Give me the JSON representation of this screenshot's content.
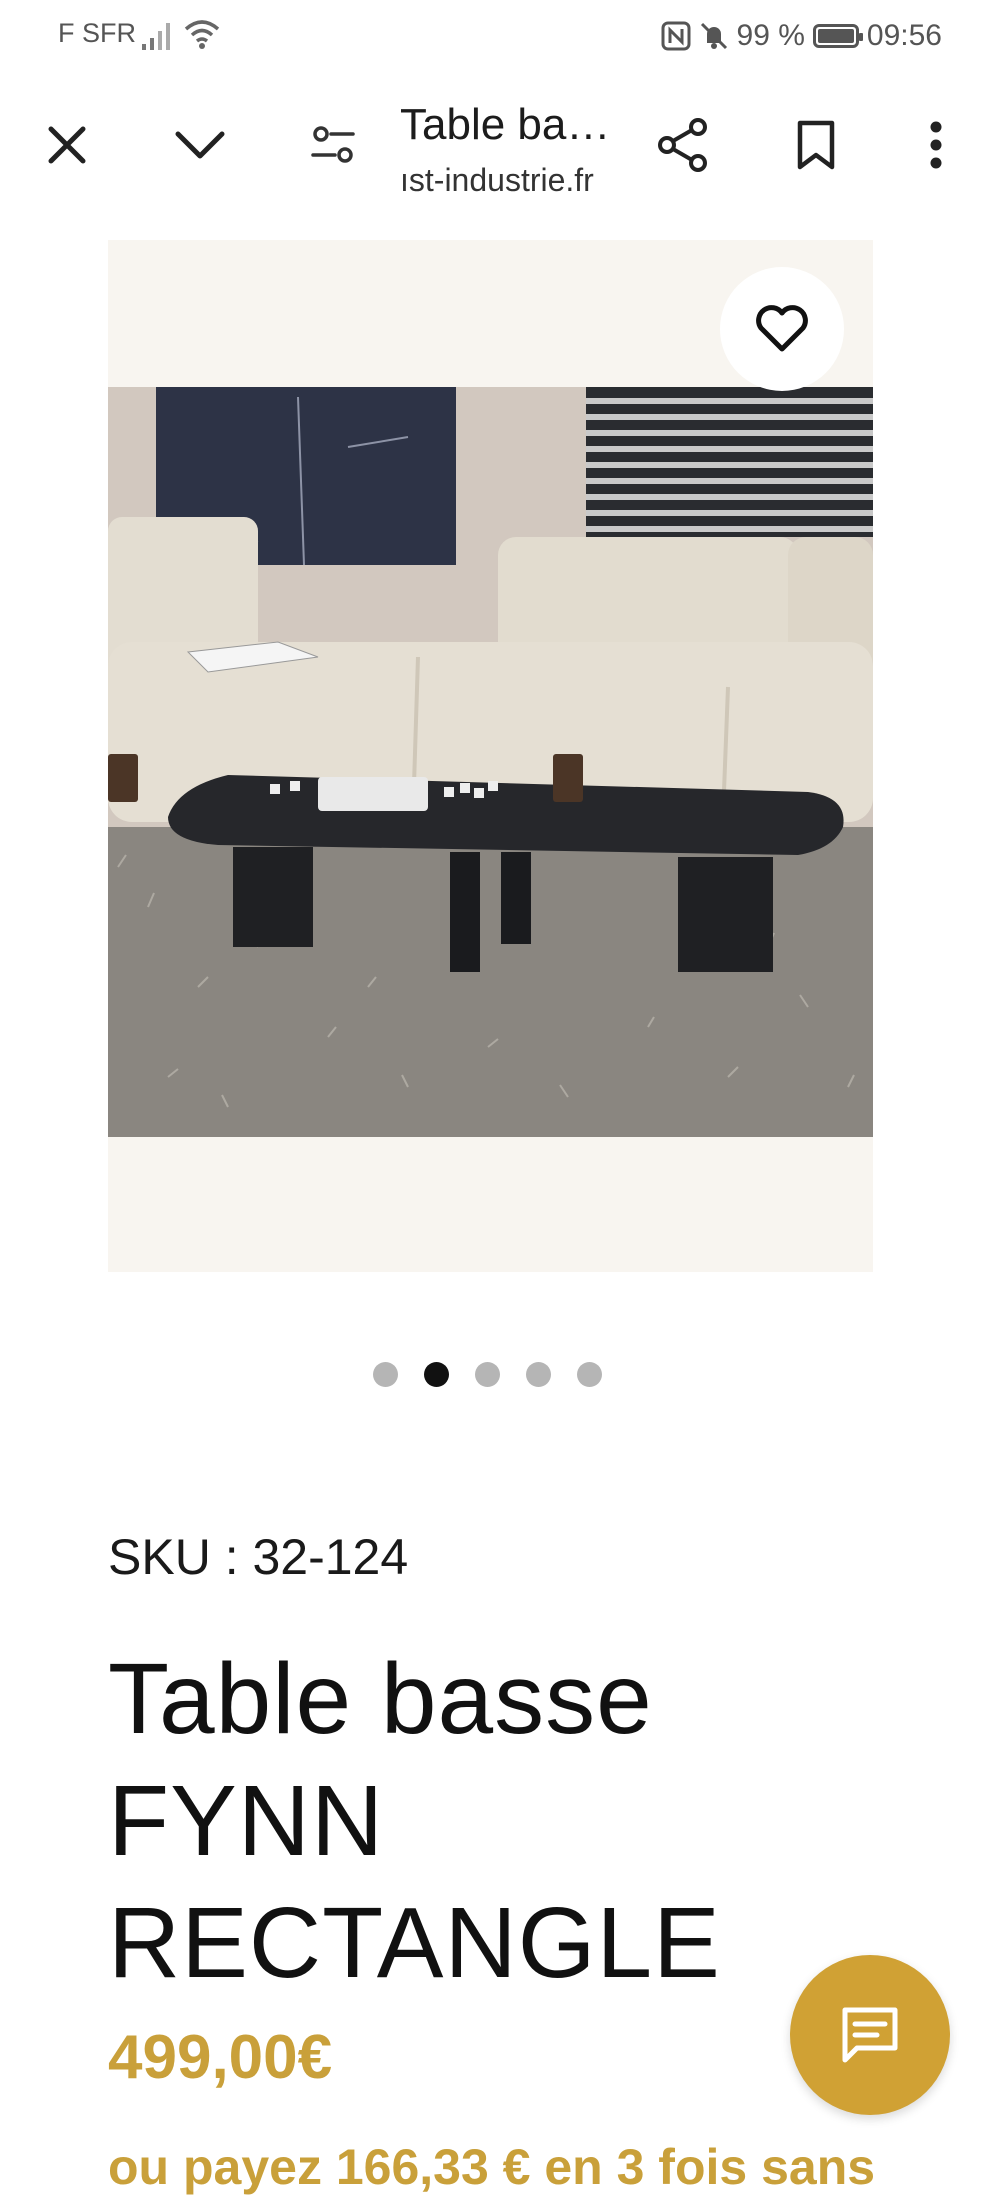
{
  "status_bar": {
    "carrier": "F SFR",
    "battery": "99 %",
    "time": "09:56"
  },
  "toolbar": {
    "title": "Table ba…",
    "domain": "ıst-industrie.fr",
    "icons": [
      "close-icon",
      "chevron-down-icon",
      "tune-icon",
      "share-icon",
      "bookmark-icon",
      "more-vert-icon"
    ]
  },
  "product": {
    "image_alt_icon": "heart-icon",
    "carousel": {
      "count": 5,
      "active_index": 1
    },
    "sku": "SKU : 32-124",
    "title_lines": [
      "Table basse",
      "FYNN",
      "RECTANGLE"
    ],
    "price": "499,00€",
    "installment_text": "ou payez 166,33 € en 3 fois sans"
  },
  "chat": {
    "icon": "chat-icon"
  },
  "colors": {
    "accent": "#c9a03a",
    "chat_button": "#d0a134",
    "text": "#111111"
  }
}
